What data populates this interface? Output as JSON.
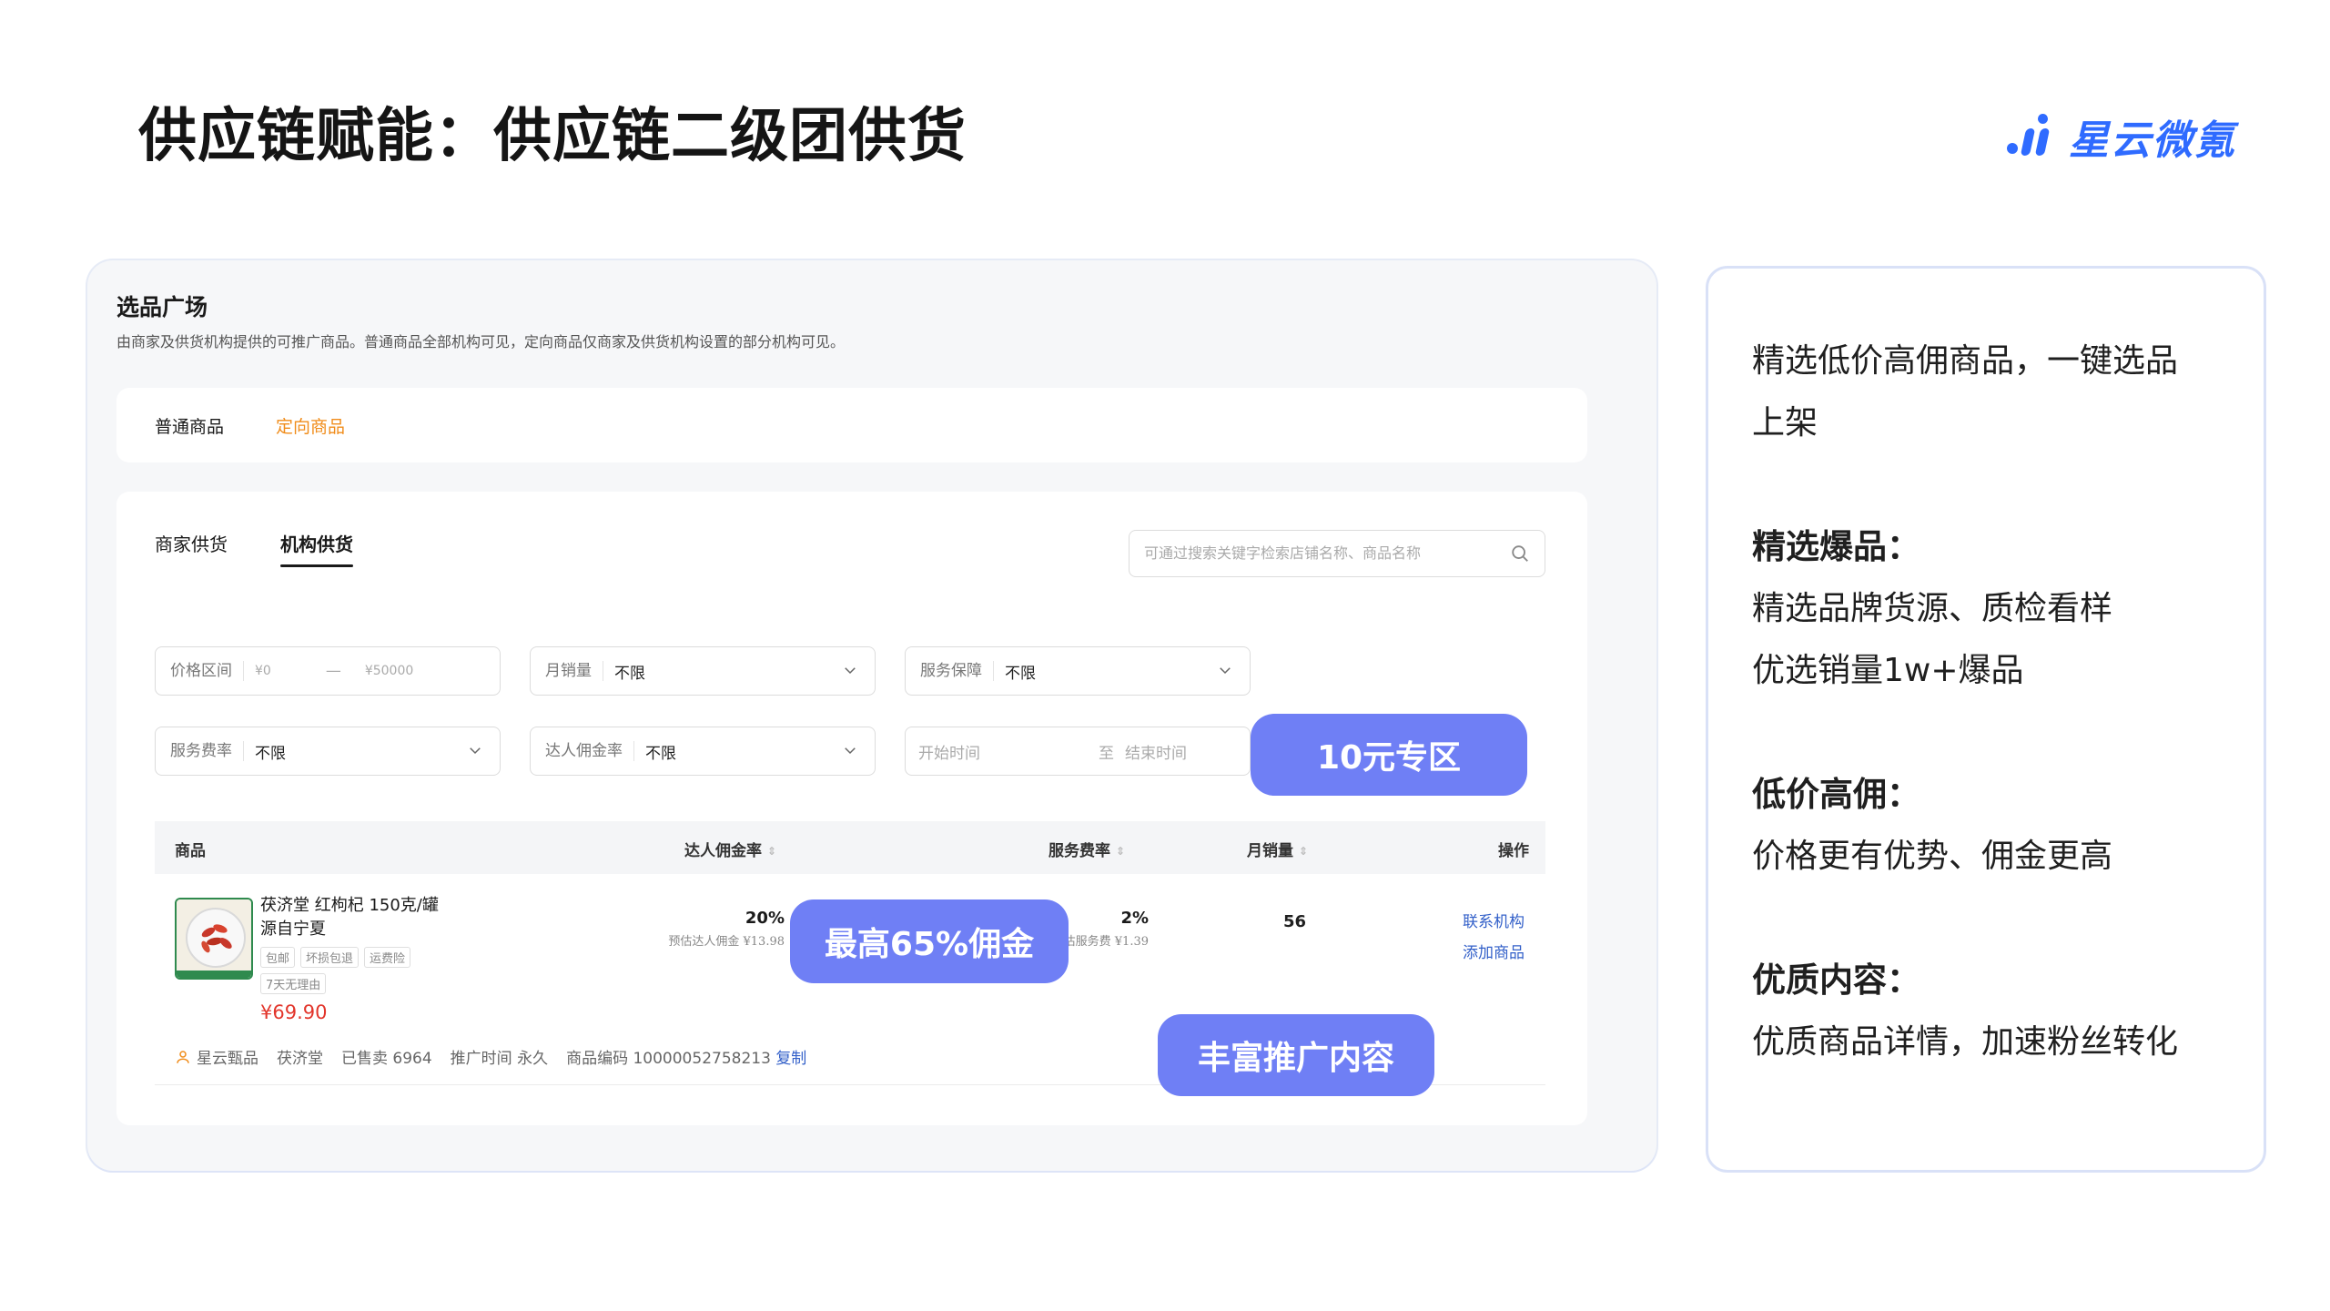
{
  "slide": {
    "title": "供应链赋能：供应链二级团供货",
    "brand": "星云微氪",
    "brand_color": "#2f6bff"
  },
  "screen": {
    "page_title": "选品广场",
    "page_desc": "由商家及供货机构提供的可推广商品。普通商品全部机构可见，定向商品仅商家及供货机构设置的部分机构可见。",
    "tabs": [
      "普通商品",
      "定向商品"
    ],
    "subtabs": [
      "商家供货",
      "机构供货"
    ],
    "search_placeholder": "可通过搜索关键字检索店铺名称、商品名称",
    "filters": {
      "price_label": "价格区间",
      "price_min": "¥0",
      "price_dash": "—",
      "price_max": "¥50000",
      "monthly_sales_label": "月销量",
      "monthly_sales_value": "不限",
      "service_label": "服务保障",
      "service_value": "不限",
      "service_fee_label": "服务费率",
      "service_fee_value": "不限",
      "commission_label": "达人佣金率",
      "commission_value": "不限",
      "start_time": "开始时间",
      "date_sep": "至",
      "end_time": "结束时间"
    },
    "table": {
      "headers": [
        "商品",
        "达人佣金率",
        "服务费率",
        "月销量",
        "操作"
      ],
      "row": {
        "name": "茯济堂 红枸杞 150克/罐 源自宁夏",
        "tags": [
          "包邮",
          "坏损包退",
          "运费险",
          "7天无理由"
        ],
        "price": "¥69.90",
        "commission": "20%",
        "commission_est": "预估达人佣金 ¥13.98",
        "service_fee": "2%",
        "service_fee_est": "预估服务费 ¥1.39",
        "monthly_sales": "56",
        "actions": [
          "联系机构",
          "添加商品"
        ],
        "supplier": "星云甄品",
        "shop": "茯济堂",
        "sold": "已售卖 6964",
        "promo_time": "推广时间 永久",
        "sku": "商品编码 10000052758213",
        "copy": "复制"
      }
    },
    "callouts": {
      "ten_yuan": "10元专区",
      "max_commission": "最高65%佣金",
      "rich_content": "丰富推广内容",
      "color": "#6f7ff5"
    }
  },
  "info": {
    "intro_line1": "精选低价高佣商品，一键选品",
    "intro_line2": "上架",
    "s1_heading": "精选爆品：",
    "s1_line1": "精选品牌货源、质检看样",
    "s1_line2": "优选销量1w+爆品",
    "s2_heading": "低价高佣：",
    "s2_line1": "价格更有优势、佣金更高",
    "s3_heading": "优质内容：",
    "s3_line1": "优质商品详情，加速粉丝转化"
  }
}
